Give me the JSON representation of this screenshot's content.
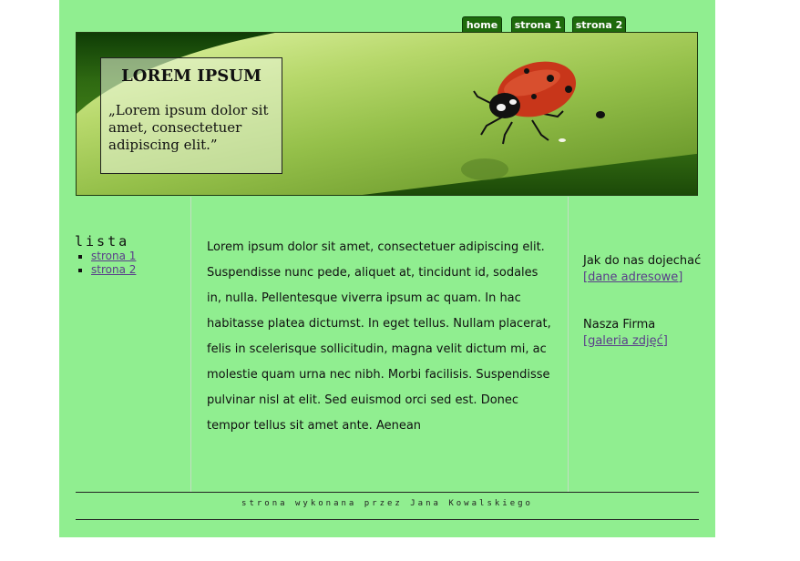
{
  "nav": {
    "home_label": "home",
    "strona1_label": "strona 1",
    "strona2_label": "strona 2"
  },
  "banner": {
    "title": "LOREM IPSUM",
    "quote": "„Lorem ipsum dolor sit amet, consectetuer adipiscing elit.”"
  },
  "sidebar": {
    "title": "lista",
    "items": [
      {
        "label": "strona 1"
      },
      {
        "label": "strona 2"
      }
    ]
  },
  "main": {
    "text": "Lorem ipsum dolor sit amet, consectetuer adipiscing elit. Suspendisse nunc pede, aliquet at, tincidunt id, sodales in, nulla. Pellentesque viverra ipsum ac quam. In hac habitasse platea dictumst. In eget tellus. Nullam placerat, felis in scelerisque sollicitudin, magna velit dictum mi, ac molestie quam urna nec nibh. Morbi facilisis. Suspendisse pulvinar nisl at elit. Sed euismod orci sed est. Donec tempor tellus sit amet ante. Aenean"
  },
  "right": {
    "block1_text": "Jak do nas dojechać",
    "block1_link": "[dane adresowe]",
    "block2_text": "Nasza Firma",
    "block2_link": "[galeria zdjęć]"
  },
  "footer": {
    "text": "strona wykonana przez Jana Kowalskiego"
  },
  "colors": {
    "page_bg": "#90ee90",
    "tab_bg": "#1e6a0c",
    "link": "#5a3e8a"
  }
}
